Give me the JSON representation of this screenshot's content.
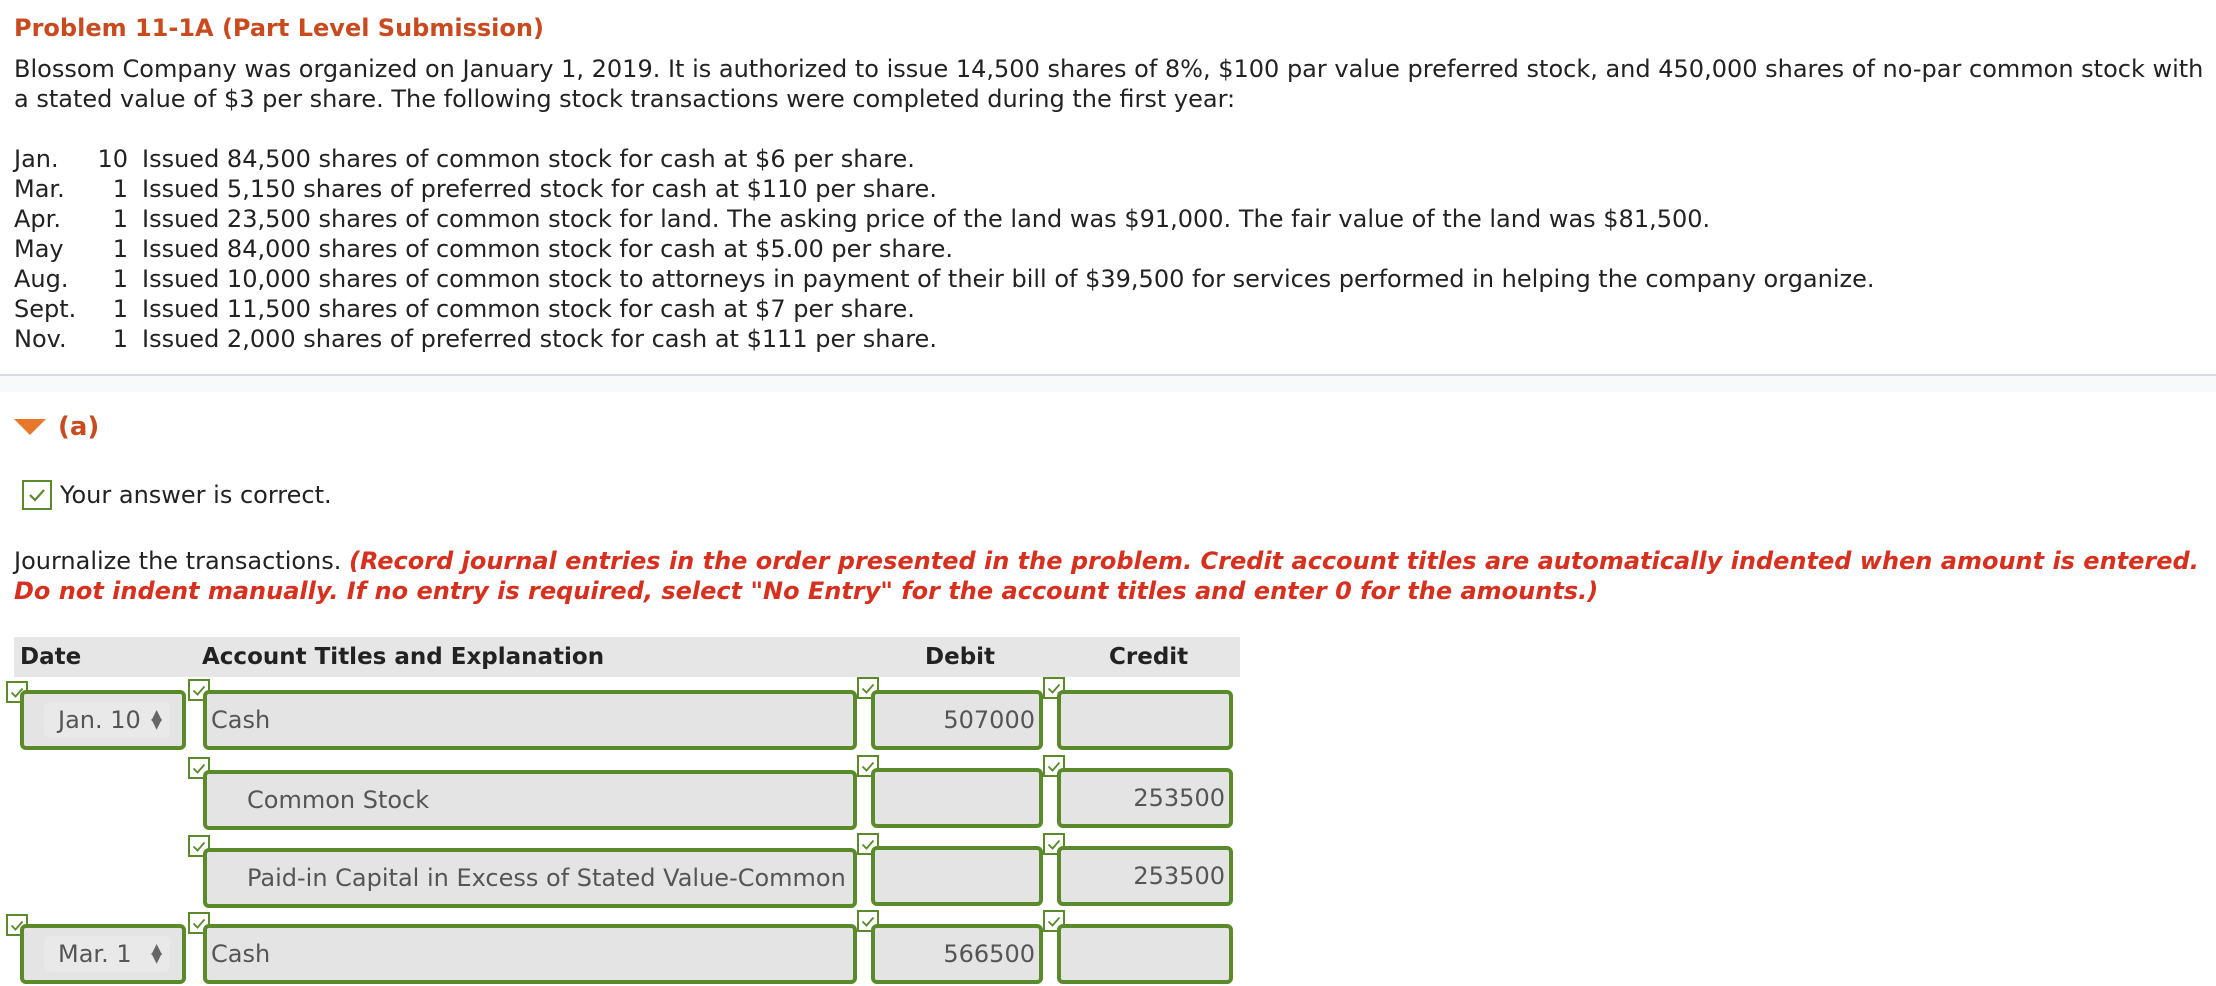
{
  "problem_title": "Problem 11-1A (Part Level Submission)",
  "intro_text": "Blossom Company was organized on January 1, 2019. It is authorized to issue 14,500 shares of 8%, $100 par value preferred stock, and 450,000 shares of no-par common stock with a stated value of $3 per share. The following stock transactions were completed during the first year:",
  "transactions": [
    {
      "month": "Jan.",
      "day": "10",
      "text": "Issued 84,500 shares of common stock for cash at $6 per share."
    },
    {
      "month": "Mar.",
      "day": "1",
      "text": "Issued 5,150 shares of preferred stock for cash at $110 per share."
    },
    {
      "month": "Apr.",
      "day": "1",
      "text": "Issued 23,500 shares of common stock for land. The asking price of the land was $91,000. The fair value of the land was $81,500."
    },
    {
      "month": "May",
      "day": "1",
      "text": "Issued 84,000 shares of common stock for cash at $5.00 per share."
    },
    {
      "month": "Aug.",
      "day": "1",
      "text": "Issued 10,000 shares of common stock to attorneys in payment of their bill of $39,500 for services performed in helping the company organize."
    },
    {
      "month": "Sept.",
      "day": "1",
      "text": "Issued 11,500 shares of common stock for cash at $7 per share."
    },
    {
      "month": "Nov.",
      "day": "1",
      "text": "Issued 2,000 shares of preferred stock for cash at $111 per share."
    }
  ],
  "section": {
    "label": "(a)"
  },
  "feedback": "Your answer is correct.",
  "instructions": {
    "lead": "Journalize the transactions. ",
    "emphasis": "(Record journal entries in the order presented in the problem. Credit account titles are automatically indented when amount is entered. Do not indent manually. If no entry is required, select \"No Entry\" for the account titles and enter 0 for the amounts.)"
  },
  "table": {
    "headers": {
      "date": "Date",
      "account": "Account Titles and Explanation",
      "debit": "Debit",
      "credit": "Credit"
    },
    "rows": [
      {
        "date": "Jan. 10",
        "account": "Cash",
        "debit": "507000",
        "credit": ""
      },
      {
        "date": "",
        "account": "Common Stock",
        "debit": "",
        "credit": "253500"
      },
      {
        "date": "",
        "account": "Paid-in Capital in Excess of Stated Value-Common",
        "debit": "",
        "credit": "253500"
      },
      {
        "date": "Mar. 1",
        "account": "Cash",
        "debit": "566500",
        "credit": ""
      }
    ]
  },
  "colors": {
    "title": "#c84a1e",
    "emphasis": "#d7301e",
    "field_border": "#5a8a2a",
    "toggle": "#e8762b"
  }
}
